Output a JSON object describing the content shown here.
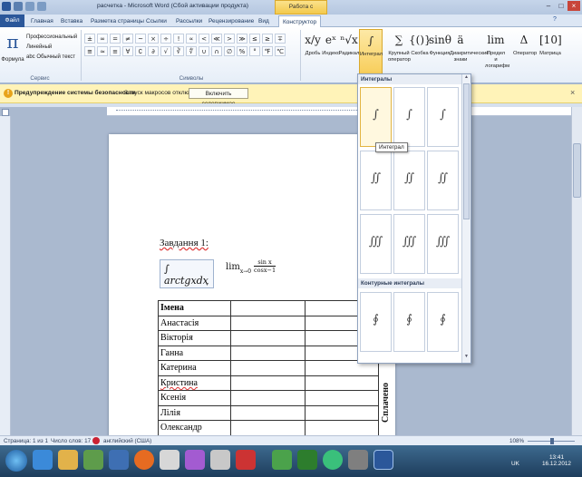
{
  "window": {
    "title": "расчетка - Microsoft Word (Сбой активации продукта)",
    "context_tab": "Работа с формулами"
  },
  "tabs": {
    "file": "Файл",
    "items": [
      "Главная",
      "Вставка",
      "Разметка страницы",
      "Ссылки",
      "Рассылки",
      "Рецензирование",
      "Вид"
    ],
    "design": "Конструктор"
  },
  "ribbon": {
    "formula_label": "Формула",
    "options": [
      "Профессиональный",
      "Линейный",
      "abc Обычный текст"
    ],
    "service_group": "Сервис",
    "symbols_group": "Символы",
    "symbols_row1": [
      "±",
      "∞",
      "=",
      "≠",
      "~",
      "×",
      "÷",
      "!",
      "∝",
      "<",
      "≪",
      ">",
      "≫",
      "≤",
      "≥",
      "∓"
    ],
    "symbols_row2": [
      "≅",
      "≈",
      "≡",
      "∀",
      "∁",
      "∂",
      "√",
      "∛",
      "∜",
      "∪",
      "∩",
      "∅",
      "%",
      "°",
      "℉",
      "℃"
    ],
    "structures": [
      {
        "glyph": "x/y",
        "label": "Дробь"
      },
      {
        "glyph": "eˣ",
        "label": "Индекс"
      },
      {
        "glyph": "ⁿ√x",
        "label": "Радикал"
      },
      {
        "glyph": "∫",
        "label": "Интеграл"
      },
      {
        "glyph": "∑",
        "label": "Крупный оператор"
      },
      {
        "glyph": "{()}",
        "label": "Скобка"
      },
      {
        "glyph": "sinθ",
        "label": "Функция"
      },
      {
        "glyph": "ä",
        "label": "Диакритические знаки"
      },
      {
        "glyph": "lim",
        "label": "Предел и логарифм"
      },
      {
        "glyph": "Δ",
        "label": "Оператор"
      },
      {
        "glyph": "[10]",
        "label": "Матрица"
      }
    ]
  },
  "security_bar": {
    "title": "Предупреждение системы безопасности",
    "message": "Запуск макросов отключен.",
    "button": "Включить содержимое"
  },
  "document": {
    "task_heading": "Завдання 1:",
    "integral_text": "∫ arctgxdx",
    "limit_text": "lim",
    "limit_sub": "x→0",
    "limit_num": "sin x",
    "limit_den": "cosx−1",
    "table": {
      "header": "Імена",
      "names": [
        "Анастасія",
        "Вікторія",
        "Ганна",
        "Катерина",
        "Кристина",
        "Ксенія",
        "Лілія",
        "Олександр"
      ]
    },
    "rotated_text": "Сплачено"
  },
  "gallery": {
    "section1": "Интегралы",
    "section2": "Контурные интегралы",
    "tooltip": "Интеграл",
    "rows": [
      [
        "∫",
        "∫",
        "∫"
      ],
      [
        "∬",
        "∬",
        "∬"
      ],
      [
        "∭",
        "∭",
        "∭"
      ],
      [
        "∮",
        "∮",
        "∮"
      ]
    ]
  },
  "statusbar": {
    "page": "Страница: 1 из 1",
    "words": "Число слов: 17",
    "language": "английский (США)",
    "zoom": "108%"
  },
  "taskbar": {
    "lang": "UK",
    "time": "13:41",
    "date": "16.12.2012"
  }
}
